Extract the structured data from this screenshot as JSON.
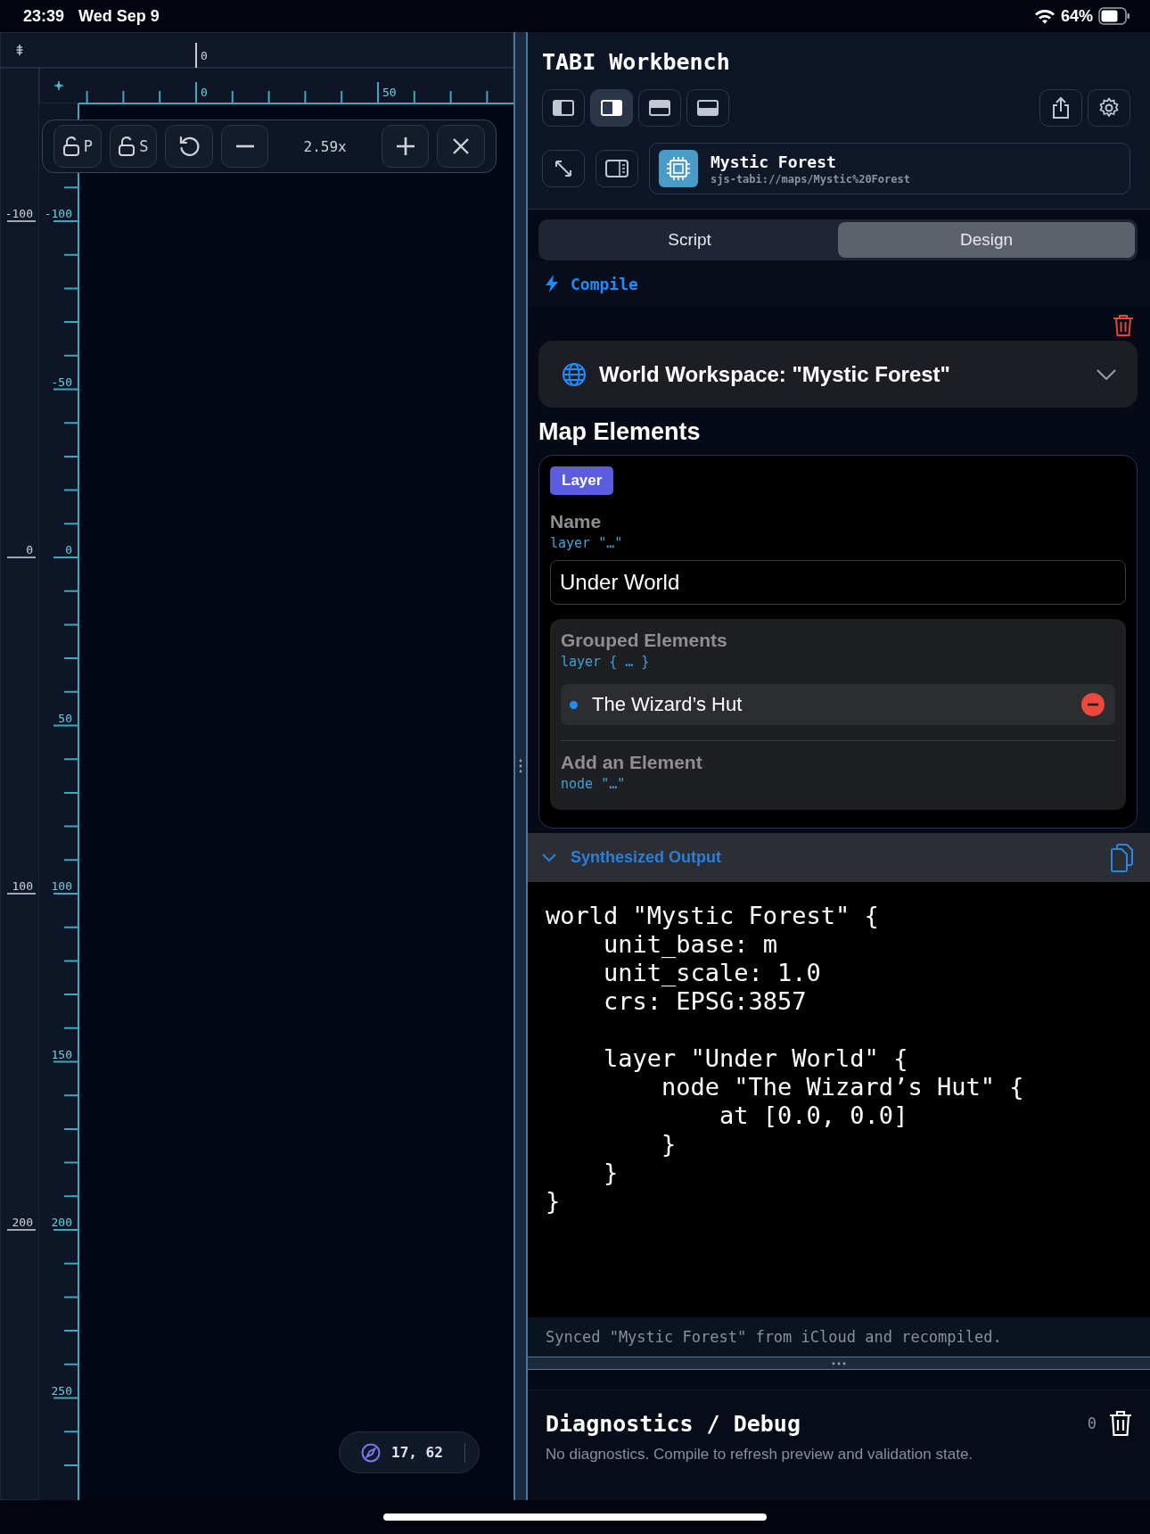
{
  "status_bar": {
    "time": "23:39",
    "date": "Wed Sep 9",
    "battery": "64%"
  },
  "canvas": {
    "top_ruler": {
      "outer_labels": [
        "0"
      ],
      "inner_labels": [
        "0",
        "50"
      ]
    },
    "left_ruler": {
      "outer_labels": [
        "-100",
        "0",
        "100",
        "200"
      ],
      "inner_labels": [
        "-100",
        "-50",
        "0",
        "50",
        "100",
        "150",
        "200",
        "250"
      ]
    },
    "toolbar": [
      {
        "kind": "lock",
        "label": "P"
      },
      {
        "kind": "lock",
        "label": "S"
      },
      {
        "kind": "reset"
      },
      {
        "kind": "minus"
      },
      {
        "kind": "readout",
        "label": "2.59x"
      },
      {
        "kind": "plus"
      },
      {
        "kind": "close"
      }
    ],
    "coordinates": "17, 62"
  },
  "sidebar": {
    "title": "TABI Workbench",
    "layout_buttons": [
      {
        "kind": "left",
        "selected": false
      },
      {
        "kind": "right",
        "selected": true
      },
      {
        "kind": "top",
        "selected": false
      },
      {
        "kind": "bottom",
        "selected": false
      }
    ],
    "document": {
      "name": "Mystic Forest",
      "url": "sjs-tabi://maps/Mystic%20Forest"
    },
    "tabs": [
      {
        "label": "Script",
        "selected": false
      },
      {
        "label": "Design",
        "selected": true
      }
    ],
    "compile": "Compile",
    "workspace": {
      "title": "World Workspace: \"Mystic Forest\""
    },
    "map_elements": {
      "heading": "Map Elements",
      "badge": "Layer",
      "name_label": "Name",
      "name_hint": "layer \"…\"",
      "name_value": "Under World",
      "grouped_label": "Grouped Elements",
      "grouped_hint": "layer { … }",
      "elements": [
        {
          "name": "The Wizard’s Hut"
        }
      ],
      "add_label": "Add an Element",
      "add_hint": "node \"…\""
    },
    "output": {
      "title": "Synthesized Output",
      "expanded": true,
      "code": "world \"Mystic Forest\" {\n    unit_base: m\n    unit_scale: 1.0\n    crs: EPSG:3857\n\n    layer \"Under World\" {\n        node \"The Wizard’s Hut\" {\n            at [0.0, 0.0]\n        }\n    }\n}",
      "status": "Synced \"Mystic Forest\" from iCloud and recompiled."
    },
    "diagnostics": {
      "title": "Diagnostics / Debug",
      "count": "0",
      "message": "No diagnostics. Compile to refresh preview and validation state."
    }
  }
}
